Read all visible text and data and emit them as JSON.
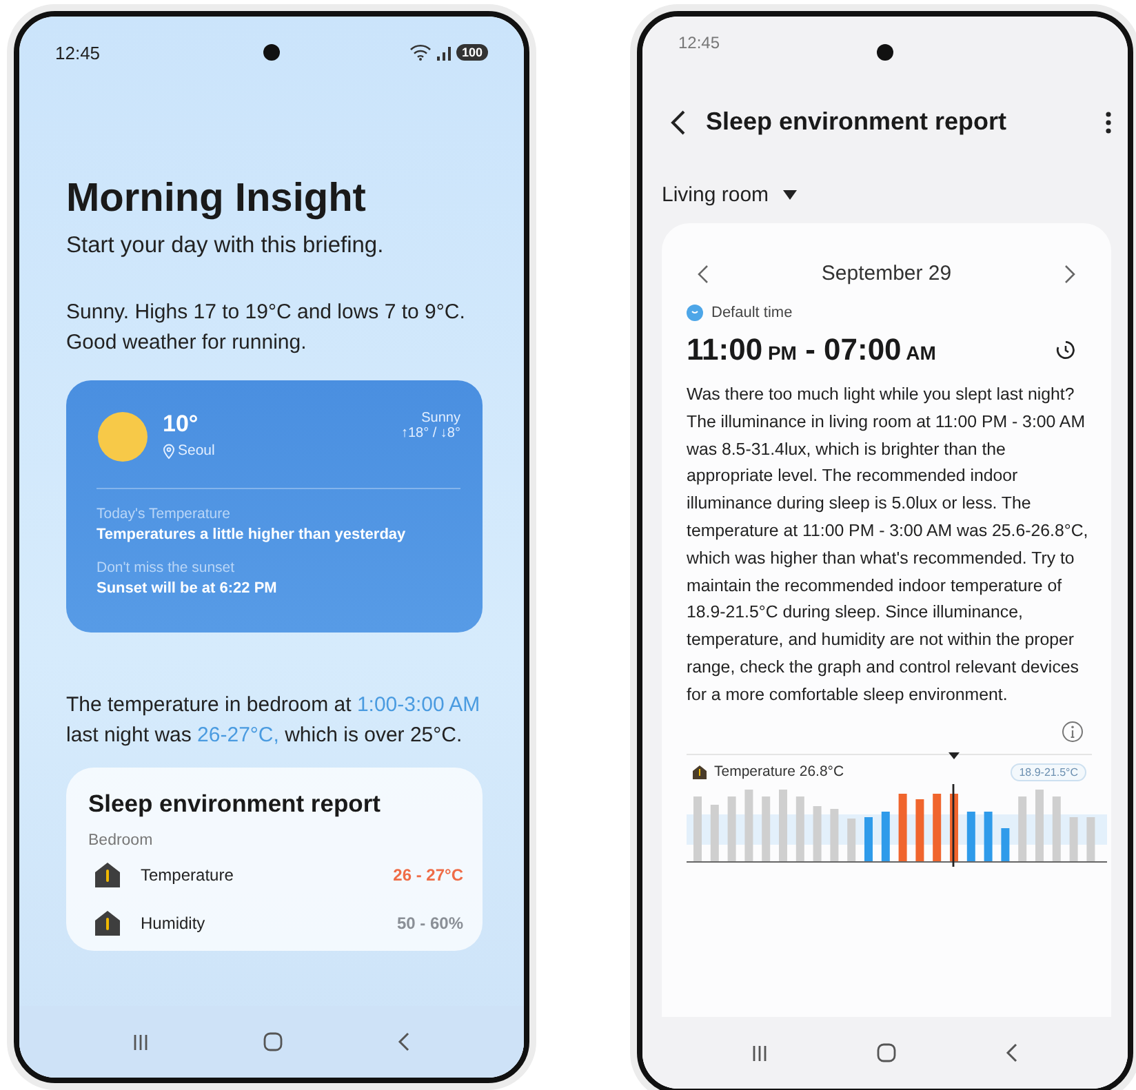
{
  "morning_insight_screen": {
    "status_bar": {
      "time": "12:45",
      "battery": "100"
    },
    "title": "Morning Insight",
    "subtitle": "Start your day with this briefing.",
    "summary": "Sunny. Highs 17 to 19°C and lows 7 to 9°C. Good weather for running.",
    "weather_card": {
      "temperature": "10°",
      "location": "Seoul",
      "condition": "Sunny",
      "high_low": "↑18° / ↓8°",
      "notes": [
        {
          "label": "Today's Temperature",
          "text": "Temperatures a little higher than yesterday"
        },
        {
          "label": "Don't miss the sunset",
          "text": "Sunset will be at 6:22 PM"
        }
      ]
    },
    "insight": [
      {
        "text": "The temperature in bedroom at ",
        "highlight": false
      },
      {
        "text": "1:00-3:00 AM",
        "highlight": true
      },
      {
        "text": " last night was ",
        "highlight": false
      },
      {
        "text": "26-27°C,",
        "highlight": true
      },
      {
        "text": " which is over 25°C.",
        "highlight": false
      }
    ],
    "sleep_card": {
      "title": "Sleep environment report",
      "room": "Bedroom",
      "rows": [
        {
          "label": "Temperature",
          "value": "26 - 27°C",
          "color": "#ef6c47"
        },
        {
          "label": "Humidity",
          "value": "50 - 60%",
          "color": "#8a8f96"
        }
      ]
    }
  },
  "sleep_report_screen": {
    "status_bar": {
      "time": "12:45"
    },
    "title": "Sleep environment report",
    "room_selector": "Living room",
    "date": "September 29",
    "schedule_label": "Default time",
    "time_range": [
      {
        "text": "11:00",
        "kind": "time"
      },
      {
        "text": " PM",
        "kind": "meridiem"
      },
      {
        "text": " - ",
        "kind": "time"
      },
      {
        "text": "07:00",
        "kind": "time"
      },
      {
        "text": " AM",
        "kind": "meridiem"
      }
    ],
    "description": "Was there too much light while you slept last night? The illuminance in living room at 11:00 PM - 3:00 AM was 8.5-31.4lux, which is brighter than the appropriate level. The recommended indoor illuminance during sleep is 5.0lux or less. The temperature at 11:00 PM - 3:00 AM was 25.6-26.8°C, which was higher than what's recommended. Try to maintain the recommended indoor temperature of 18.9-21.5°C during sleep. Since illuminance, temperature, and humidity are not within the proper range, check the graph and control relevant devices for a more comfortable sleep environment.",
    "graph": {
      "label": "Temperature 26.8°C",
      "range": "18.9-21.5°C"
    }
  }
}
